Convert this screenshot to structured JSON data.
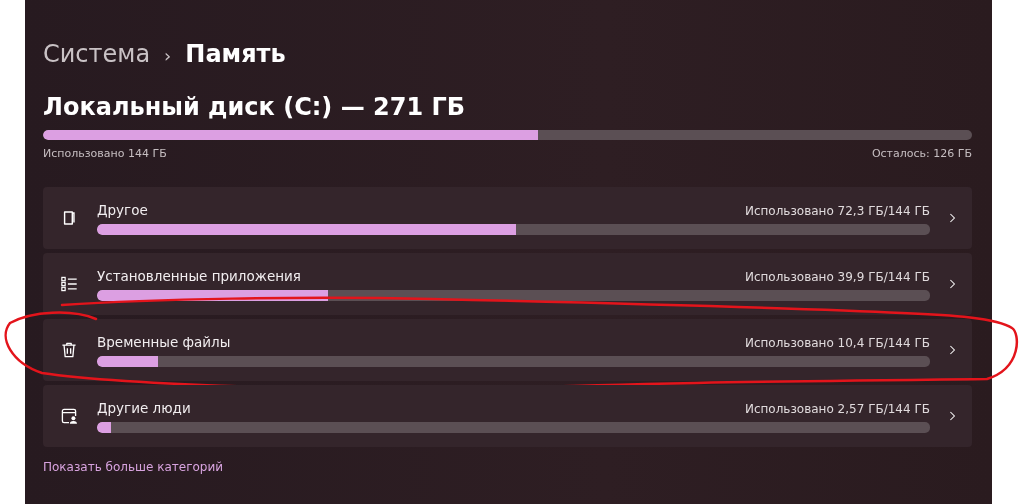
{
  "breadcrumb": {
    "parent": "Система",
    "separator": "›",
    "current": "Память"
  },
  "disk": {
    "title": "Локальный диск (C:) — 271 ГБ",
    "level": 0.533,
    "used": "Использовано 144 ГБ",
    "free": "Осталось: 126 ГБ"
  },
  "categories": [
    {
      "kind": "document",
      "name": "Другое",
      "usage": "Использовано 72,3 ГБ/144 ГБ",
      "level": 0.503,
      "circled": false
    },
    {
      "kind": "apps",
      "name": "Установленные приложения",
      "usage": "Использовано 39,9 ГБ/144 ГБ",
      "level": 0.277,
      "circled": false
    },
    {
      "kind": "trash",
      "name": "Временные файлы",
      "usage": "Использовано 10,4 ГБ/144 ГБ",
      "level": 0.073,
      "circled": true
    },
    {
      "kind": "people",
      "name": "Другие люди",
      "usage": "Использовано 2,57 ГБ/144 ГБ",
      "level": 0.017,
      "circled": false
    }
  ],
  "more_link": "Показать больше категорий"
}
